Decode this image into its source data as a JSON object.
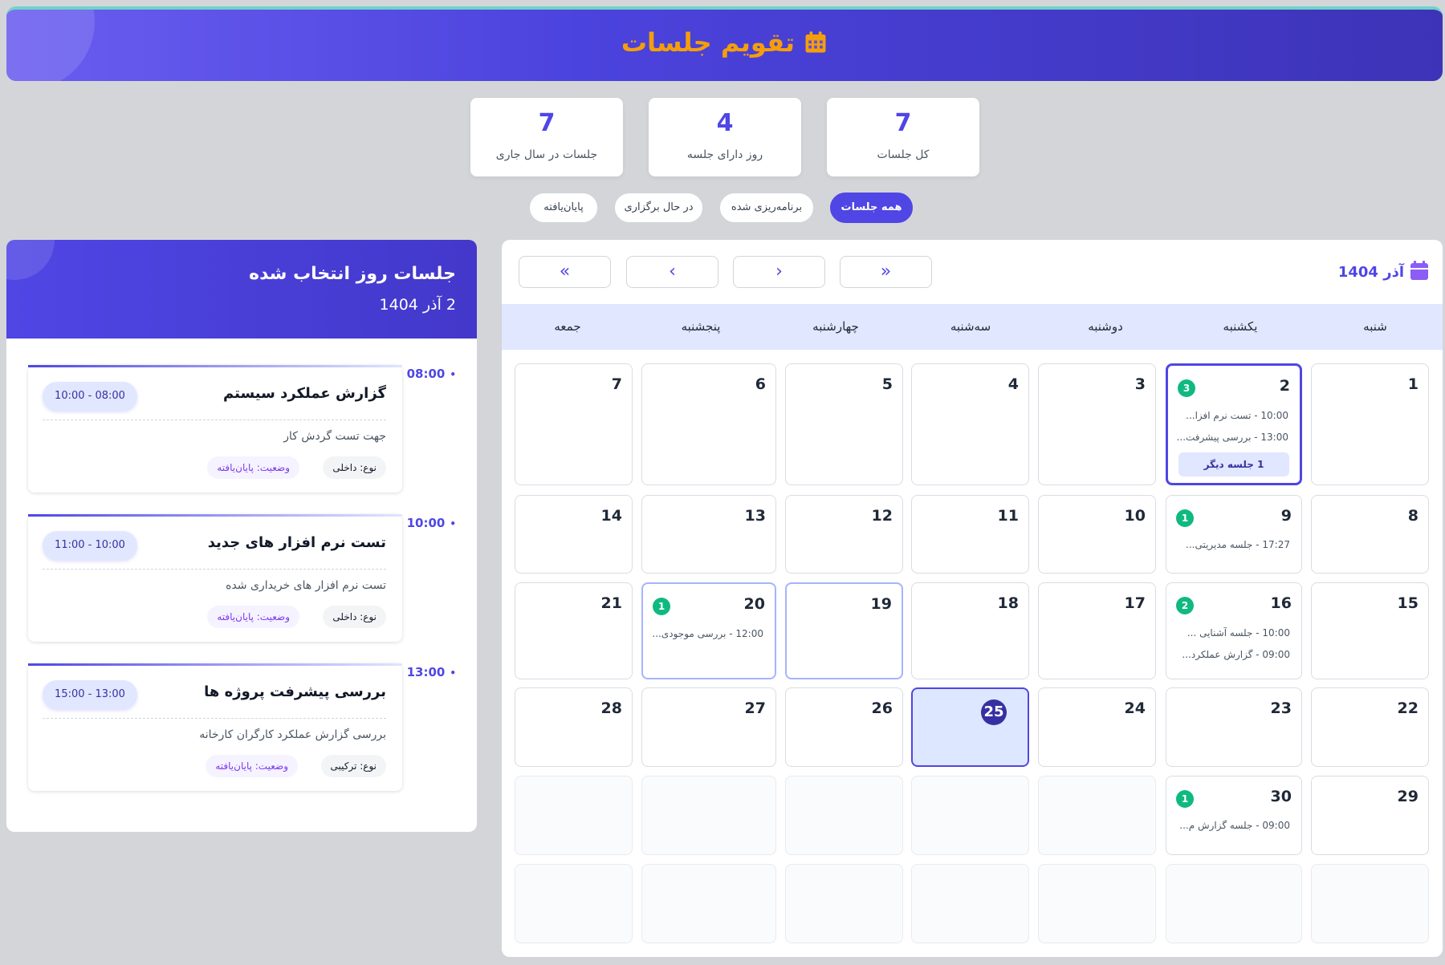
{
  "header": {
    "title": "تقویم جلسات",
    "icon": "calendar-icon",
    "accent": "#f59e0b"
  },
  "stats": [
    {
      "value": "7",
      "label": "کل جلسات"
    },
    {
      "value": "4",
      "label": "روز دارای جلسه"
    },
    {
      "value": "7",
      "label": "جلسات در سال جاری"
    }
  ],
  "filters": [
    {
      "label": "همه جلسات",
      "active": true
    },
    {
      "label": "برنامه‌ریزی شده",
      "active": false
    },
    {
      "label": "در حال برگزاری",
      "active": false
    },
    {
      "label": "پایان‌یافته",
      "active": false
    }
  ],
  "calendar": {
    "month_label": "آذر 1404",
    "nav": {
      "prev_year": "«",
      "prev_month": "‹",
      "next_month": "›",
      "next_year": "»"
    },
    "weekdays": [
      "شنبه",
      "یکشنبه",
      "دوشنبه",
      "سه‌شنبه",
      "چهارشنبه",
      "پنجشنبه",
      "جمعه"
    ],
    "days": {
      "d1": "1",
      "d2": "2",
      "d3": "3",
      "d4": "4",
      "d5": "5",
      "d6": "6",
      "d7": "7",
      "d8": "8",
      "d9": "9",
      "d10": "10",
      "d11": "11",
      "d12": "12",
      "d13": "13",
      "d14": "14",
      "d15": "15",
      "d16": "16",
      "d17": "17",
      "d18": "18",
      "d19": "19",
      "d20": "20",
      "d21": "21",
      "d22": "22",
      "d23": "23",
      "d24": "24",
      "d25": "25",
      "d26": "26",
      "d27": "27",
      "d28": "28",
      "d29": "29",
      "d30": "30"
    },
    "events": {
      "d2": {
        "count": "3",
        "lines": [
          "10:00 - تست نرم افزا...",
          "13:00 - بررسی پیشرفت..."
        ],
        "more": "1 جلسه دیگر"
      },
      "d9": {
        "count": "1",
        "lines": [
          "17:27 - جلسه مدیریتی..."
        ]
      },
      "d16": {
        "count": "2",
        "lines": [
          "10:00 - جلسه آشنایی ...",
          "09:00 - گزارش عملکرد..."
        ]
      },
      "d20": {
        "count": "1",
        "lines": [
          "12:00 - بررسی موجودی..."
        ]
      },
      "d30": {
        "count": "1",
        "lines": [
          "09:00 - جلسه گزارش م..."
        ]
      }
    },
    "today": "25",
    "selected": "2"
  },
  "sidebar": {
    "title": "جلسات روز انتخاب شده",
    "date": "2 آذر 1404",
    "meetings": [
      {
        "time": "08:00",
        "title": "گزارش عملکرد سیستم",
        "range": "10:00 - 08:00",
        "desc": "جهت تست گردش کار",
        "type": "نوع: داخلی",
        "status": "وضعیت: پایان‌یافته"
      },
      {
        "time": "10:00",
        "title": "تست نرم افزار های جدید",
        "range": "11:00 - 10:00",
        "desc": "تست نرم افزار های خریداری شده",
        "type": "نوع: داخلی",
        "status": "وضعیت: پایان‌یافته"
      },
      {
        "time": "13:00",
        "title": "بررسی پیشرفت پروژه ها",
        "range": "15:00 - 13:00",
        "desc": "بررسی گزارش عملکرد کارگران کارخانه",
        "type": "نوع: ترکیبی",
        "status": "وضعیت: پایان‌یافته"
      }
    ]
  }
}
